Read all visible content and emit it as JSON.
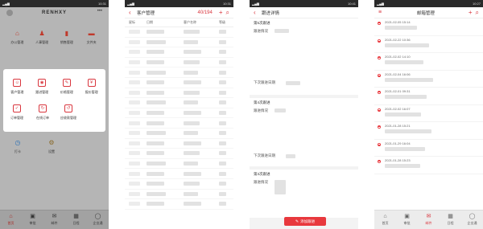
{
  "phone1": {
    "status_time": "10:31",
    "logo": "RENHXY",
    "more": "•••",
    "grid": [
      {
        "label": "办公管理",
        "icon": "office-icon",
        "glyph": "⌂"
      },
      {
        "label": "人事管理",
        "icon": "personnel-icon",
        "glyph": "♟"
      },
      {
        "label": "销售管理",
        "icon": "sales-icon",
        "glyph": "▮"
      },
      {
        "label": "文件夹",
        "icon": "folder-icon",
        "glyph": "▬"
      }
    ],
    "popup_row1": [
      {
        "label": "客户管理",
        "icon": "customer-icon",
        "glyph": "☺"
      },
      {
        "label": "跟进管理",
        "icon": "follow-up-icon",
        "glyph": "◉"
      },
      {
        "label": "价格管理",
        "icon": "price-icon",
        "glyph": "✎"
      },
      {
        "label": "报价管理",
        "icon": "quote-icon",
        "glyph": "¥"
      }
    ],
    "popup_row2": [
      {
        "label": "订单管理",
        "icon": "order-icon",
        "glyph": "✓"
      },
      {
        "label": "在线订单",
        "icon": "online-order-icon",
        "glyph": "↻"
      },
      {
        "label": "应收款管理",
        "icon": "receivable-icon",
        "glyph": "↺"
      }
    ],
    "bottom_row": [
      {
        "label": "打卡",
        "icon": "clock-in-icon",
        "glyph": "◷"
      },
      {
        "label": "设置",
        "icon": "settings-icon",
        "glyph": "⚙"
      }
    ],
    "tabs": [
      {
        "label": "首页",
        "icon": "home-icon",
        "glyph": "⌂",
        "active": true
      },
      {
        "label": "审批",
        "icon": "approval-icon",
        "glyph": "▣",
        "active": false
      },
      {
        "label": "邮件",
        "icon": "mail-icon",
        "glyph": "✉",
        "active": false
      },
      {
        "label": "日程",
        "icon": "calendar-icon",
        "glyph": "▦",
        "active": false
      },
      {
        "label": "企业通",
        "icon": "chat-icon",
        "glyph": "◯",
        "active": false
      }
    ]
  },
  "phone2": {
    "status_time": "10:31",
    "title": "客户管理",
    "count": "40/194",
    "add_glyph": "+",
    "search_glyph": "⌕",
    "back_glyph": "‹",
    "columns": [
      "星标",
      "日期",
      "客户名称",
      "等级"
    ],
    "row_count": 18
  },
  "phone3": {
    "status_time": "10:41",
    "title": "跟进详情",
    "back_glyph": "‹",
    "blocks": [
      {
        "title": "第5次跟进",
        "situation_label": "跟进情况",
        "next_label": "下次跟进日期"
      },
      {
        "title": "第4次跟进",
        "situation_label": "跟进情况",
        "next_label": "下次跟进日期"
      },
      {
        "title": "第3次跟进",
        "situation_label": "跟进情况",
        "next_label": ""
      }
    ],
    "add_button": "添加跟进",
    "add_glyph": "✎"
  },
  "phone4": {
    "status_time": "10:27",
    "title": "邮箱管理",
    "menu_glyph": "≡",
    "add_glyph": "+",
    "search_glyph": "⌕",
    "mails": [
      {
        "date": "2021-02-05 15:14"
      },
      {
        "date": "2021-02-22 10:36"
      },
      {
        "date": "2021-02-02 14:10"
      },
      {
        "date": "2021-02-04 16:06"
      },
      {
        "date": "2021-02-01 09:31"
      },
      {
        "date": "2021-02-02 16:07"
      },
      {
        "date": "2021-01-28 15:21"
      },
      {
        "date": "2021-01-29 16:04"
      },
      {
        "date": "2021-01-28 15:23"
      }
    ],
    "tabs": [
      {
        "label": "首页",
        "icon": "home-icon",
        "glyph": "⌂",
        "active": false
      },
      {
        "label": "审批",
        "icon": "approval-icon",
        "glyph": "▣",
        "active": false
      },
      {
        "label": "邮件",
        "icon": "mail-icon",
        "glyph": "✉",
        "active": true
      },
      {
        "label": "日程",
        "icon": "calendar-icon",
        "glyph": "▦",
        "active": false
      },
      {
        "label": "企业通",
        "icon": "chat-icon",
        "glyph": "◯",
        "active": false
      }
    ]
  }
}
